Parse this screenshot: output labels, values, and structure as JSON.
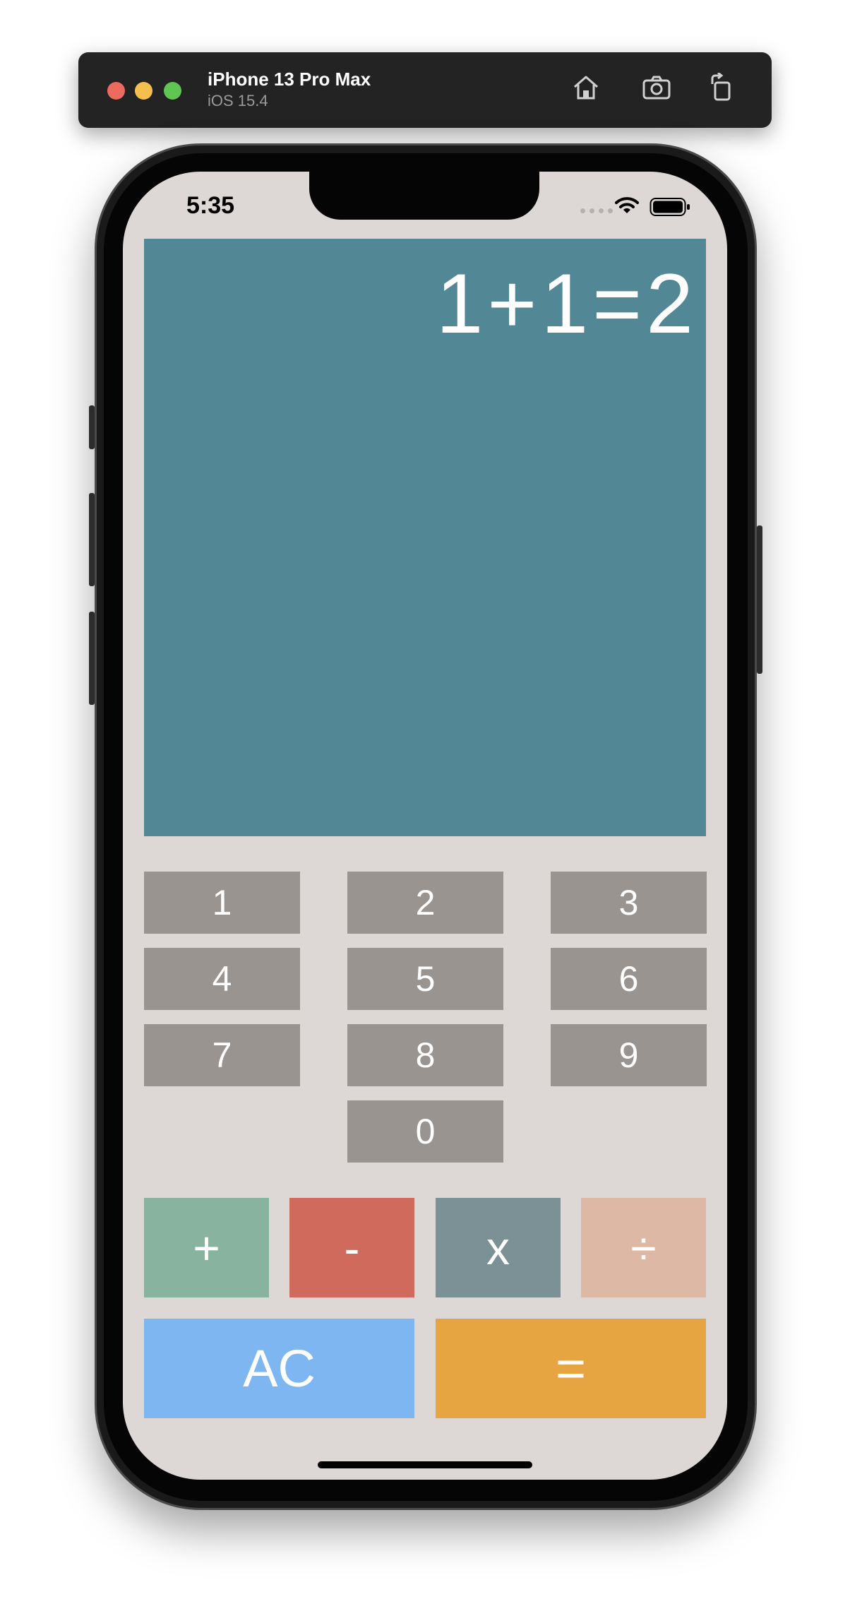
{
  "simulator": {
    "device_name": "iPhone 13 Pro Max",
    "os_version": "iOS 15.4",
    "buttons": {
      "home": "home-icon",
      "screenshot": "camera-icon",
      "rotate": "rotate-icon"
    }
  },
  "status_bar": {
    "time": "5:35"
  },
  "calculator": {
    "display": "1+1=2",
    "digits": [
      "1",
      "2",
      "3",
      "4",
      "5",
      "6",
      "7",
      "8",
      "9",
      "0"
    ],
    "operators": {
      "add": "+",
      "subtract": "-",
      "multiply": "x",
      "divide": "÷"
    },
    "clear": "AC",
    "equals": "="
  },
  "colors": {
    "screen_bg": "#ddd8d6",
    "display_bg": "#528795",
    "digit_bg": "#9a9491",
    "add_bg": "#88b39e",
    "subtract_bg": "#d06a5c",
    "multiply_bg": "#7b9196",
    "divide_bg": "#dcb8a5",
    "clear_bg": "#7db6f1",
    "equals_bg": "#e7a542"
  }
}
